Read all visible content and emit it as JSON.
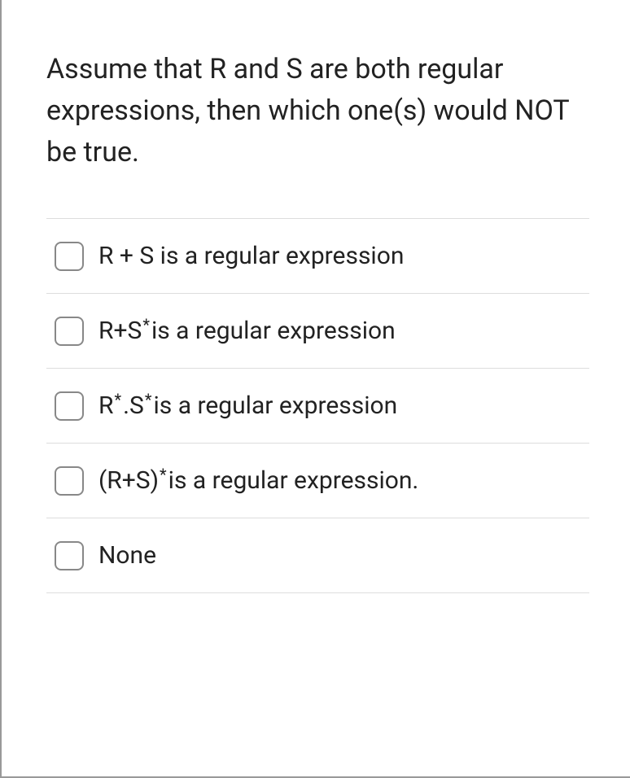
{
  "question": "Assume that R and S are both regular expressions, then which one(s) would NOT be true.",
  "options": [
    {
      "segments": [
        {
          "text": "R + S is a regular expression",
          "sup": false
        }
      ]
    },
    {
      "segments": [
        {
          "text": "R+S",
          "sup": false
        },
        {
          "text": "*",
          "sup": true
        },
        {
          "text": " is a regular expression",
          "sup": false
        }
      ]
    },
    {
      "segments": [
        {
          "text": "R",
          "sup": false
        },
        {
          "text": "*",
          "sup": true
        },
        {
          "text": ".S",
          "sup": false
        },
        {
          "text": "*",
          "sup": true
        },
        {
          "text": " is a regular expression",
          "sup": false
        }
      ]
    },
    {
      "segments": [
        {
          "text": "(R+S)",
          "sup": false
        },
        {
          "text": "*",
          "sup": true
        },
        {
          "text": " is a regular expression.",
          "sup": false
        }
      ]
    },
    {
      "segments": [
        {
          "text": "None",
          "sup": false
        }
      ]
    }
  ]
}
